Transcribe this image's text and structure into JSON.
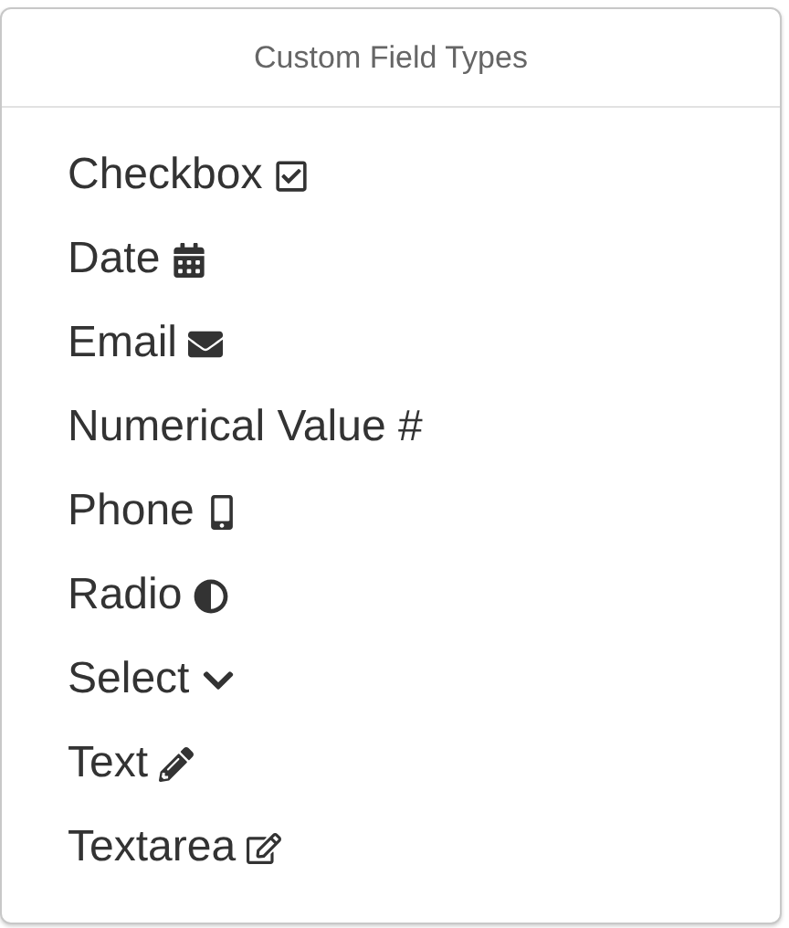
{
  "popover": {
    "title": "Custom Field Types",
    "items": [
      {
        "label": "Checkbox",
        "kind": "checkbox"
      },
      {
        "label": "Date",
        "kind": "date"
      },
      {
        "label": "Email",
        "kind": "email"
      },
      {
        "label": "Numerical Value #",
        "kind": "number"
      },
      {
        "label": "Phone",
        "kind": "phone"
      },
      {
        "label": "Radio",
        "kind": "radio"
      },
      {
        "label": "Select",
        "kind": "select"
      },
      {
        "label": "Text",
        "kind": "text"
      },
      {
        "label": "Textarea",
        "kind": "textarea"
      }
    ]
  }
}
